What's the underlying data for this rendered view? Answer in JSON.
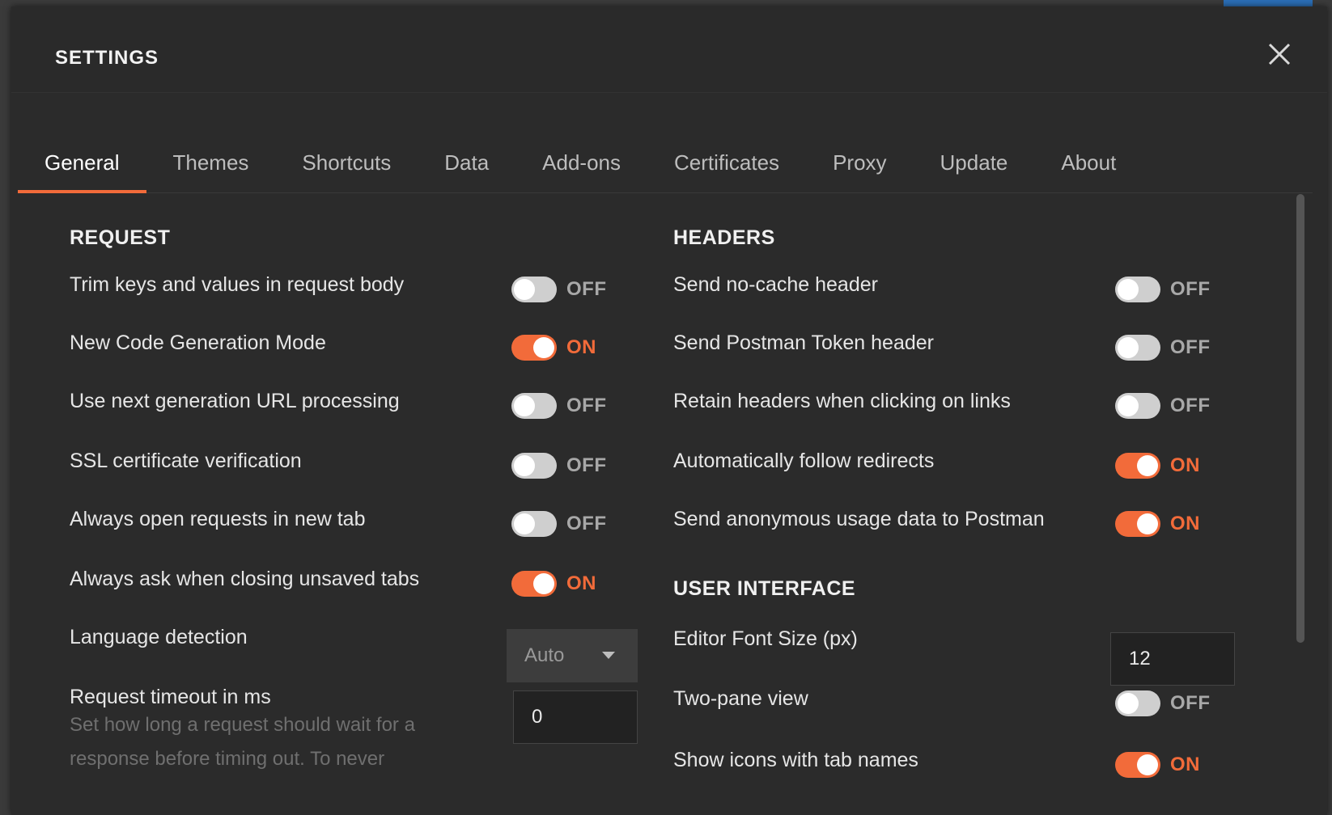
{
  "settings": {
    "title": "SETTINGS",
    "close_icon": "close-icon",
    "tabs": [
      {
        "label": "General",
        "active": true
      },
      {
        "label": "Themes"
      },
      {
        "label": "Shortcuts"
      },
      {
        "label": "Data"
      },
      {
        "label": "Add-ons"
      },
      {
        "label": "Certificates"
      },
      {
        "label": "Proxy"
      },
      {
        "label": "Update"
      },
      {
        "label": "About"
      }
    ]
  },
  "request": {
    "title": "REQUEST",
    "rows": [
      {
        "label": "Trim keys and values in request body",
        "state": "OFF"
      },
      {
        "label": "New Code Generation Mode",
        "state": "ON"
      },
      {
        "label": "Use next generation URL processing",
        "state": "OFF"
      },
      {
        "label": "SSL certificate verification",
        "state": "OFF"
      },
      {
        "label": "Always open requests in new tab",
        "state": "OFF"
      },
      {
        "label": "Always ask when closing unsaved tabs",
        "state": "ON"
      }
    ],
    "language_detection": {
      "label": "Language detection",
      "value": "Auto"
    },
    "request_timeout": {
      "label": "Request timeout in ms",
      "value": "0"
    },
    "timeout_help": "Set how long a request should wait for a response before timing out. To never"
  },
  "headers": {
    "title": "HEADERS",
    "rows": [
      {
        "label": "Send no-cache header",
        "state": "OFF"
      },
      {
        "label": "Send Postman Token header",
        "state": "OFF"
      },
      {
        "label": "Retain headers when clicking on links",
        "state": "OFF"
      },
      {
        "label": "Automatically follow redirects",
        "state": "ON"
      },
      {
        "label": "Send anonymous usage data to Postman",
        "state": "ON"
      }
    ]
  },
  "user_interface": {
    "title": "USER INTERFACE",
    "font_size": {
      "label": "Editor Font Size (px)",
      "value": "12"
    },
    "rows": [
      {
        "label": "Two-pane view",
        "state": "OFF"
      },
      {
        "label": "Show icons with tab names",
        "state": "ON"
      }
    ]
  },
  "colors": {
    "accent": "#f26b3a",
    "background": "#2b2b2b"
  }
}
